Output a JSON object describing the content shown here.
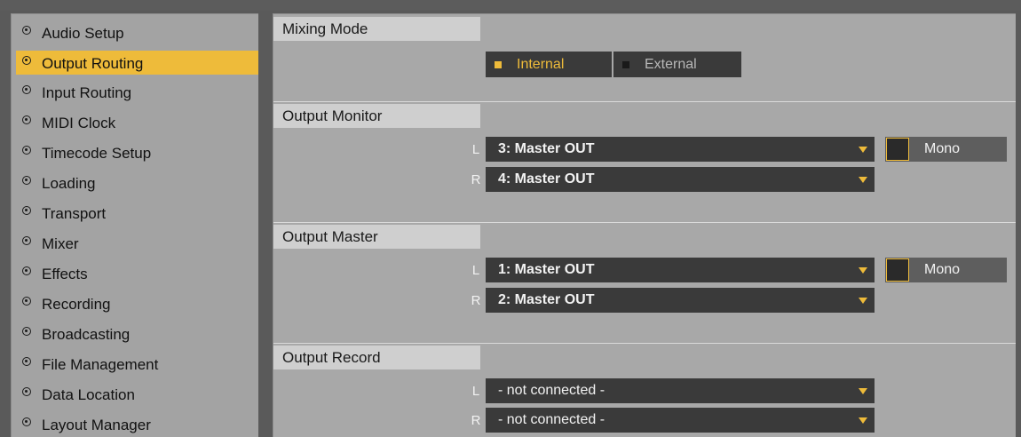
{
  "sidebar": {
    "items": [
      {
        "label": "Audio Setup",
        "active": false
      },
      {
        "label": "Output Routing",
        "active": true
      },
      {
        "label": "Input Routing",
        "active": false
      },
      {
        "label": "MIDI Clock",
        "active": false
      },
      {
        "label": "Timecode Setup",
        "active": false
      },
      {
        "label": "Loading",
        "active": false
      },
      {
        "label": "Transport",
        "active": false
      },
      {
        "label": "Mixer",
        "active": false
      },
      {
        "label": "Effects",
        "active": false
      },
      {
        "label": "Recording",
        "active": false
      },
      {
        "label": "Broadcasting",
        "active": false
      },
      {
        "label": "File Management",
        "active": false
      },
      {
        "label": "Data Location",
        "active": false
      },
      {
        "label": "Layout Manager",
        "active": false
      }
    ]
  },
  "mixing_mode": {
    "title": "Mixing Mode",
    "options": [
      {
        "label": "Internal",
        "selected": true
      },
      {
        "label": "External",
        "selected": false
      }
    ]
  },
  "output_monitor": {
    "title": "Output Monitor",
    "left": {
      "channel": "L",
      "value": "3: Master OUT"
    },
    "right": {
      "channel": "R",
      "value": "4: Master OUT"
    },
    "mono_label": "Mono",
    "mono_checked": false
  },
  "output_master": {
    "title": "Output Master",
    "left": {
      "channel": "L",
      "value": "1: Master OUT"
    },
    "right": {
      "channel": "R",
      "value": "2: Master OUT"
    },
    "mono_label": "Mono",
    "mono_checked": false
  },
  "output_record": {
    "title": "Output Record",
    "left": {
      "channel": "L",
      "value": "- not connected -"
    },
    "right": {
      "channel": "R",
      "value": "- not connected -"
    }
  },
  "icons": {
    "sidebar_bullet": "radio-bullet-icon",
    "dropdown_caret": "chevron-down-icon"
  },
  "colors": {
    "accent": "#eebb3a",
    "panel": "#a8a8a8",
    "sidebar": "#a3a3a3",
    "control_bg": "#3a3a3a",
    "header_bg": "#cfcfcf"
  }
}
